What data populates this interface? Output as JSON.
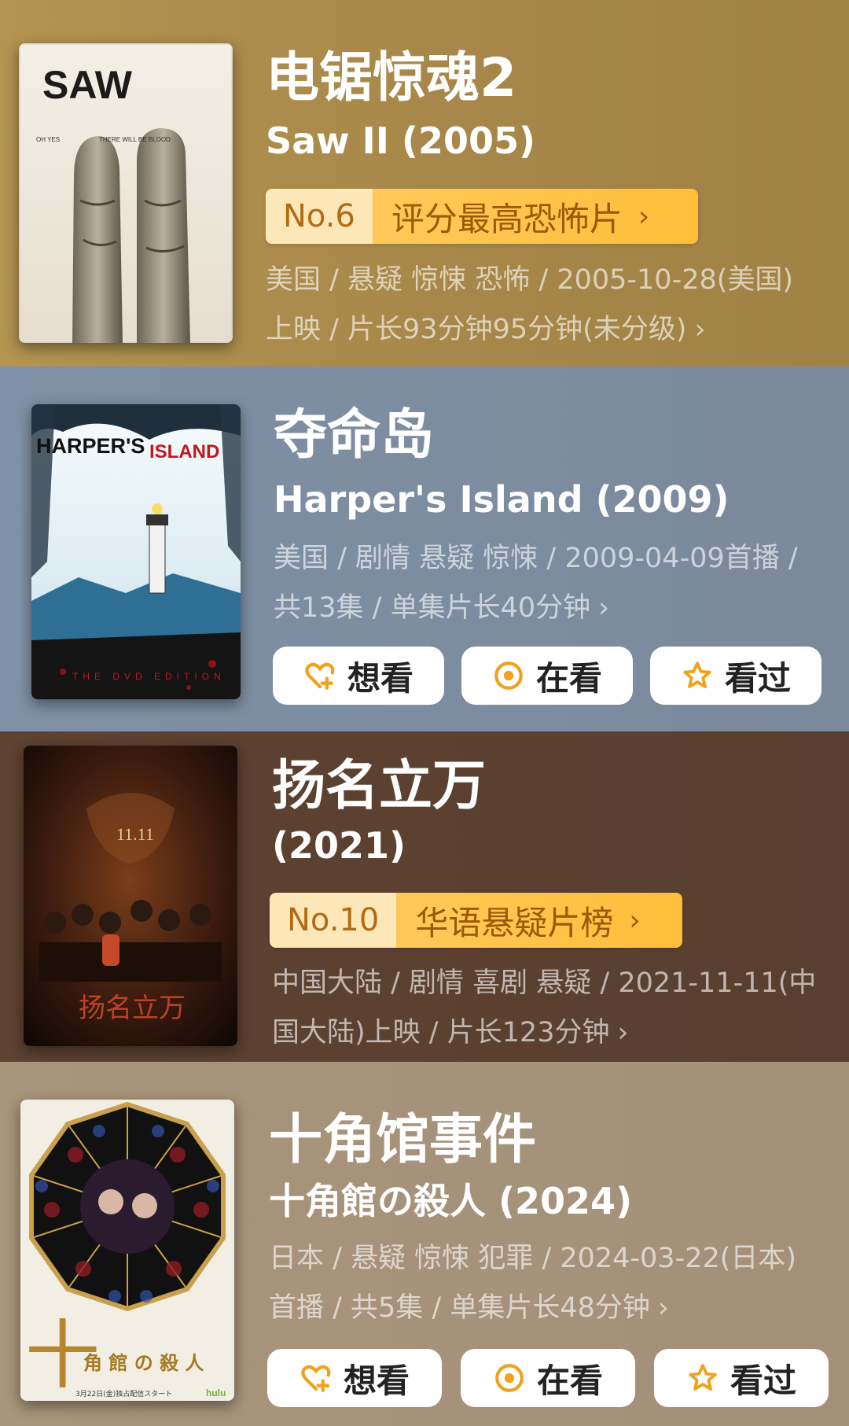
{
  "items": [
    {
      "title": "电锯惊魂2",
      "subtitle": "Saw II (2005)",
      "rank": {
        "num": "No.6",
        "label": "评分最高恐怖片"
      },
      "meta": "美国 / 悬疑 惊悚 恐怖 / 2005-10-28(美国)上映 / 片长93分钟95分钟(未分级)",
      "poster": {
        "logo": "SAW",
        "tag1": "OH YES",
        "tag2": "THERE WILL BE BLOOD"
      }
    },
    {
      "title": "夺命岛",
      "subtitle": "Harper's Island (2009)",
      "meta": "美国 / 剧情 悬疑 惊悚 / 2009-04-09首播 / 共13集 / 单集片长40分钟",
      "poster": {
        "logo_a": "HARPER'S",
        "logo_b": "ISLAND",
        "edition": "THE DVD EDITION"
      }
    },
    {
      "title": "扬名立万",
      "subtitle": "(2021)",
      "rank": {
        "num": "No.10",
        "label": "华语悬疑片榜"
      },
      "meta": "中国大陆 / 剧情 喜剧 悬疑 / 2021-11-11(中国大陆)上映 / 片长123分钟",
      "poster": {
        "date": "11.11",
        "calligraphy": "扬名立万"
      }
    },
    {
      "title": "十角馆事件",
      "subtitle": "十角館の殺人 (2024)",
      "meta": "日本 / 悬疑 惊悚 犯罪 / 2024-03-22(日本)首播 / 共5集 / 单集片长48分钟",
      "poster": {
        "big": "十",
        "rest": "角 館 の 殺 人",
        "brand": "hulu",
        "release": "3月22日(金)独占配信スタート"
      }
    }
  ],
  "buttons": {
    "want": "想看",
    "watching": "在看",
    "watched": "看过"
  },
  "chevron": "›",
  "colors": {
    "card1": "#a8884b",
    "card2": "#7e8ea2",
    "card3": "#5f4333",
    "card4": "#a8957a",
    "rank_num_bg": "#fbe7b8",
    "rank_label_bg": "#ffc34a",
    "icon": "#f0a21a"
  }
}
